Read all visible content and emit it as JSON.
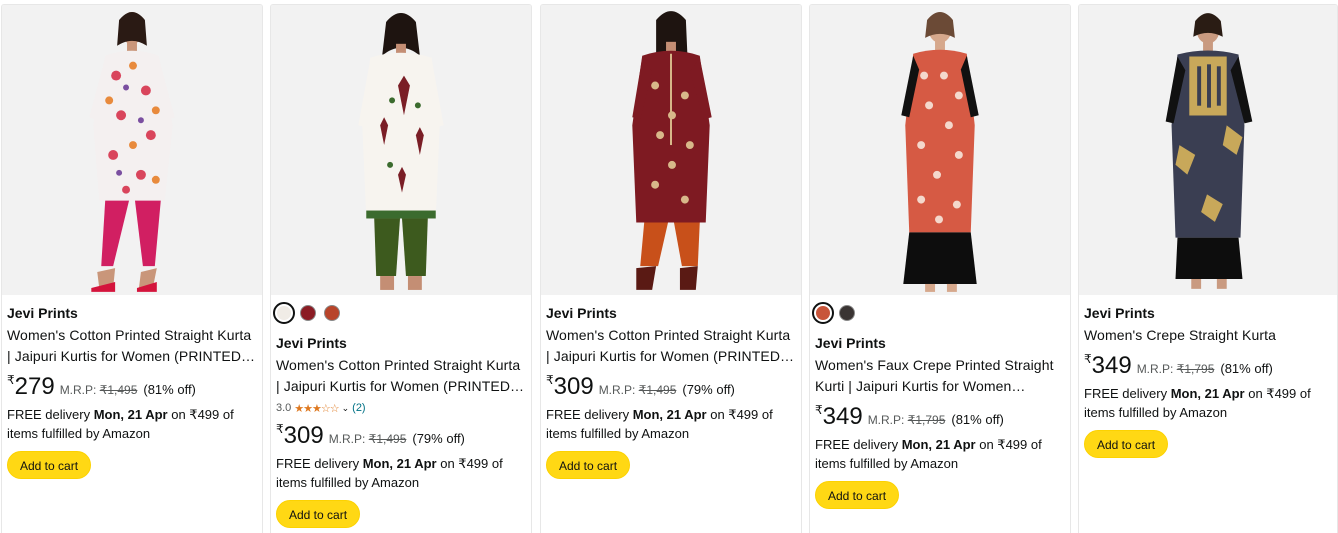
{
  "colors": {
    "accent_button": "#ffd814",
    "star": "#de7921",
    "link": "#007185"
  },
  "cards": [
    {
      "image": "woman-floral-kurta-photo",
      "swatches": [],
      "brand": "Jevi Prints",
      "title": "Women's Cotton Printed Straight Kurta | Jaipuri Kurtis for Women (PRINTED KURTA)",
      "rating": null,
      "currency": "₹",
      "price": "279",
      "mrp_label": "M.R.P:",
      "mrp": "₹1,495",
      "discount": "(81% off)",
      "delivery_prefix": "FREE delivery ",
      "delivery_date": "Mon, 21 Apr",
      "delivery_suffix": " on ₹499 of items fulfilled by Amazon",
      "cart_label": "Add to cart"
    },
    {
      "image": "woman-white-block-print-kurta-photo",
      "swatches": [
        "#f0ece6",
        "#8b1c24",
        "#b8442a"
      ],
      "brand": "Jevi Prints",
      "title": "Women's Cotton Printed Straight Kurta | Jaipuri Kurtis for Women (PRINTED KURTA)",
      "rating": {
        "value": "3.0",
        "stars": "★★★☆☆",
        "count": "(2)"
      },
      "currency": "₹",
      "price": "309",
      "mrp_label": "M.R.P:",
      "mrp": "₹1,495",
      "discount": "(79% off)",
      "delivery_prefix": "FREE delivery ",
      "delivery_date": "Mon, 21 Apr",
      "delivery_suffix": " on ₹499 of items fulfilled by Amazon",
      "cart_label": "Add to cart"
    },
    {
      "image": "woman-maroon-kurta-photo",
      "swatches": [],
      "brand": "Jevi Prints",
      "title": "Women's Cotton Printed Straight Kurta | Jaipuri Kurtis for Women (PRINTED KURTA)",
      "rating": null,
      "currency": "₹",
      "price": "309",
      "mrp_label": "M.R.P:",
      "mrp": "₹1,495",
      "discount": "(79% off)",
      "delivery_prefix": "FREE delivery ",
      "delivery_date": "Mon, 21 Apr",
      "delivery_suffix": " on ₹499 of items fulfilled by Amazon",
      "cart_label": "Add to cart"
    },
    {
      "image": "woman-rust-printed-kurta-photo",
      "swatches": [
        "#c8553a",
        "#3a3433"
      ],
      "brand": "Jevi Prints",
      "title": "Women's Faux Crepe Printed Straight Kurti | Jaipuri Kurtis for Women (PRINTED KURTI)",
      "rating": null,
      "currency": "₹",
      "price": "349",
      "mrp_label": "M.R.P:",
      "mrp": "₹1,795",
      "discount": "(81% off)",
      "delivery_prefix": "FREE delivery ",
      "delivery_date": "Mon, 21 Apr",
      "delivery_suffix": " on ₹499 of items fulfilled by Amazon",
      "cart_label": "Add to cart"
    },
    {
      "image": "woman-navy-crepe-kurta-photo",
      "swatches": [],
      "brand": "Jevi Prints",
      "title": "Women's Crepe Straight Kurta",
      "rating": null,
      "currency": "₹",
      "price": "349",
      "mrp_label": "M.R.P:",
      "mrp": "₹1,795",
      "discount": "(81% off)",
      "delivery_prefix": "FREE delivery ",
      "delivery_date": "Mon, 21 Apr",
      "delivery_suffix": " on ₹499 of items fulfilled by Amazon",
      "cart_label": "Add to cart"
    }
  ]
}
